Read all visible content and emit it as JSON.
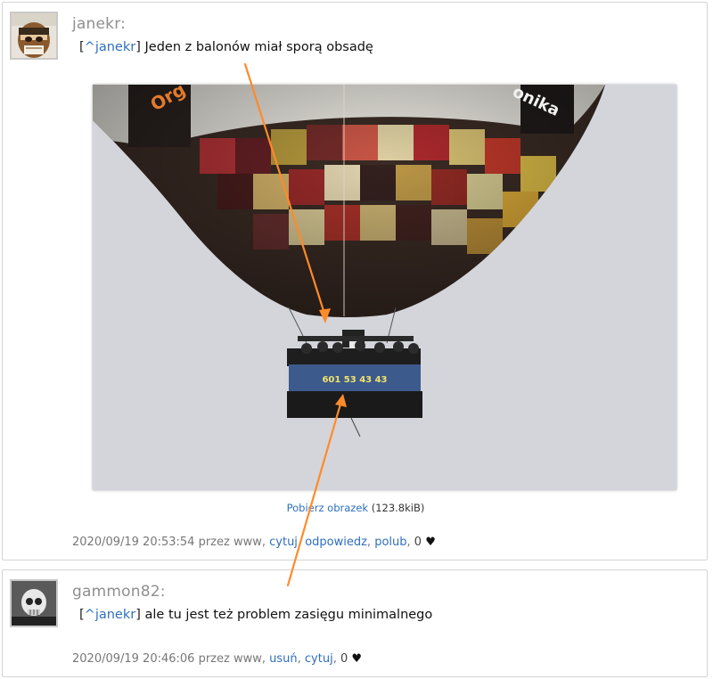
{
  "posts": [
    {
      "author": "janekr:",
      "quote_open": "[",
      "quote_user": "^janekr",
      "quote_close": "]",
      "text": " Jeden z balonów miał sporą obsadę",
      "download_label": "Pobierz obrazek",
      "download_size": " (123.8kiB)",
      "timestamp": "2020/09/19 20:53:54",
      "by": " przez www, ",
      "actions": [
        "cytuj",
        "odpowiedz",
        "polub"
      ],
      "likes": "0"
    },
    {
      "author": "gammon82:",
      "quote_open": "[",
      "quote_user": "^janekr",
      "quote_close": "]",
      "text": " ale tu jest też problem zasięgu minimalnego",
      "timestamp": "2020/09/19 20:46:06",
      "by": " przez www, ",
      "actions": [
        "usuń",
        "cytuj"
      ],
      "likes": "0"
    }
  ],
  "photo": {
    "balloon_text_left": "Org",
    "balloon_text_right": "onika",
    "basket_banner": "601 53 43 43"
  },
  "colors": {
    "link": "#2f6fbf",
    "arrow": "#ff8a2a",
    "author": "#8f8f8f",
    "sky": "#d4d6db"
  },
  "icons": [
    "heart-icon",
    "avatar-janekr",
    "avatar-gammon82",
    "annotation-arrow"
  ]
}
